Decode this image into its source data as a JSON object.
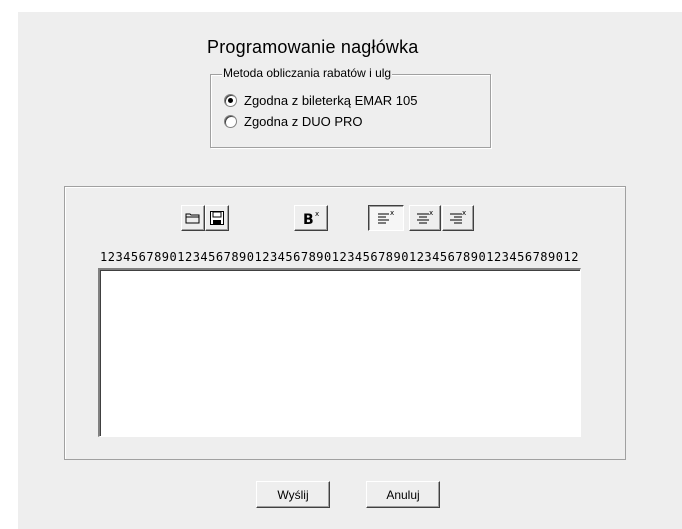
{
  "dialog": {
    "title": "Programowanie nagłówka"
  },
  "rabat_group": {
    "legend": "Metoda obliczania rabatów i ulg",
    "options": [
      {
        "label": "Zgodna z bileterką EMAR 105",
        "checked": true
      },
      {
        "label": "Zgodna z DUO PRO",
        "checked": false
      }
    ]
  },
  "toolbar": {
    "buttons": [
      {
        "name": "open-icon"
      },
      {
        "name": "save-icon"
      },
      {
        "name": "bold-icon",
        "label": "B"
      },
      {
        "name": "align-left-icon",
        "pressed": true
      },
      {
        "name": "align-center-icon"
      },
      {
        "name": "align-right-icon"
      }
    ]
  },
  "editor": {
    "ruler": "12345678901234567890123456789012345678901234567890123456789012",
    "content": ""
  },
  "actions": {
    "send_label": "Wyślij",
    "cancel_label": "Anuluj"
  }
}
